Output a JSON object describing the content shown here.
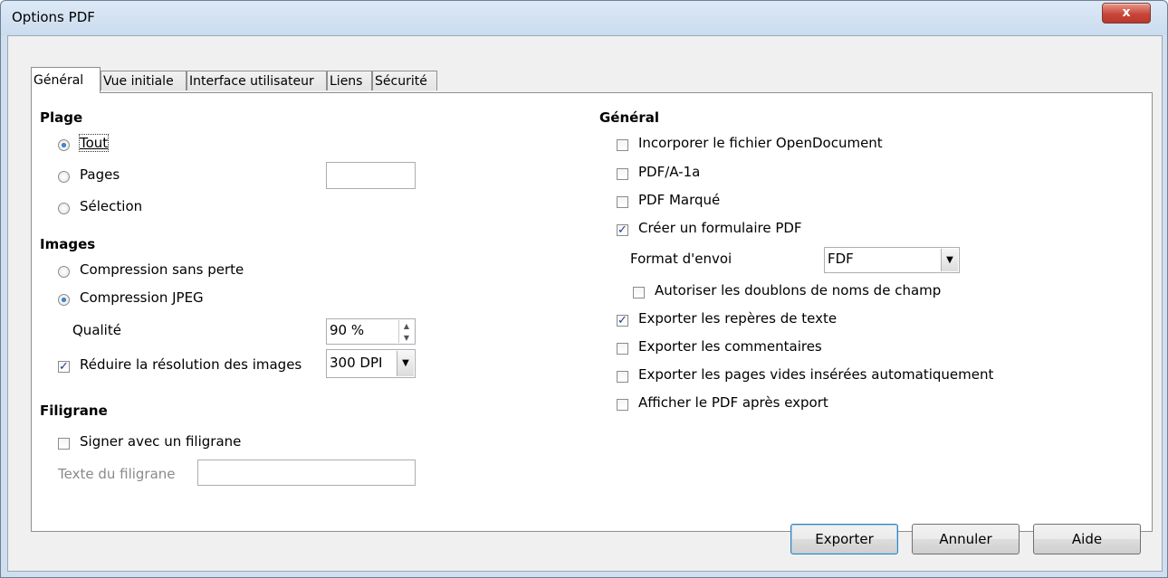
{
  "window": {
    "title": "Options PDF",
    "close_glyph": "x"
  },
  "tabs": [
    "Général",
    "Vue initiale",
    "Interface utilisateur",
    "Liens",
    "Sécurité"
  ],
  "range": {
    "heading": "Plage",
    "all": "Tout",
    "pages": "Pages",
    "pages_value": "",
    "selection": "Sélection",
    "selected": "Tout"
  },
  "images": {
    "heading": "Images",
    "lossless": "Compression sans perte",
    "jpeg": "Compression JPEG",
    "selected": "Compression JPEG",
    "quality_label": "Qualité",
    "quality_value": "90 %",
    "reduce_label": "Réduire la résolution des images",
    "reduce_checked": true,
    "resolution_value": "300 DPI"
  },
  "watermark": {
    "heading": "Filigrane",
    "sign_label": "Signer avec un filigrane",
    "sign_checked": false,
    "text_label": "Texte du filigrane",
    "text_value": ""
  },
  "general": {
    "heading": "Général",
    "options": [
      {
        "label": "Incorporer le fichier OpenDocument",
        "checked": false
      },
      {
        "label": "PDF/A-1a",
        "checked": false
      },
      {
        "label": "PDF Marqué",
        "checked": false
      },
      {
        "label": "Créer un formulaire PDF",
        "checked": true
      }
    ],
    "submit_format_label": "Format d'envoi",
    "submit_format_value": "FDF",
    "allow_duplicates": {
      "label": "Autoriser les doublons de noms de champ",
      "checked": false
    },
    "more_options": [
      {
        "label": "Exporter les repères de texte",
        "checked": true
      },
      {
        "label": "Exporter les commentaires",
        "checked": false
      },
      {
        "label": "Exporter les pages vides insérées automatiquement",
        "checked": false
      },
      {
        "label": "Afficher le PDF après export",
        "checked": false
      }
    ]
  },
  "buttons": {
    "export": "Exporter",
    "cancel": "Annuler",
    "help": "Aide"
  },
  "check_glyph": "✓"
}
